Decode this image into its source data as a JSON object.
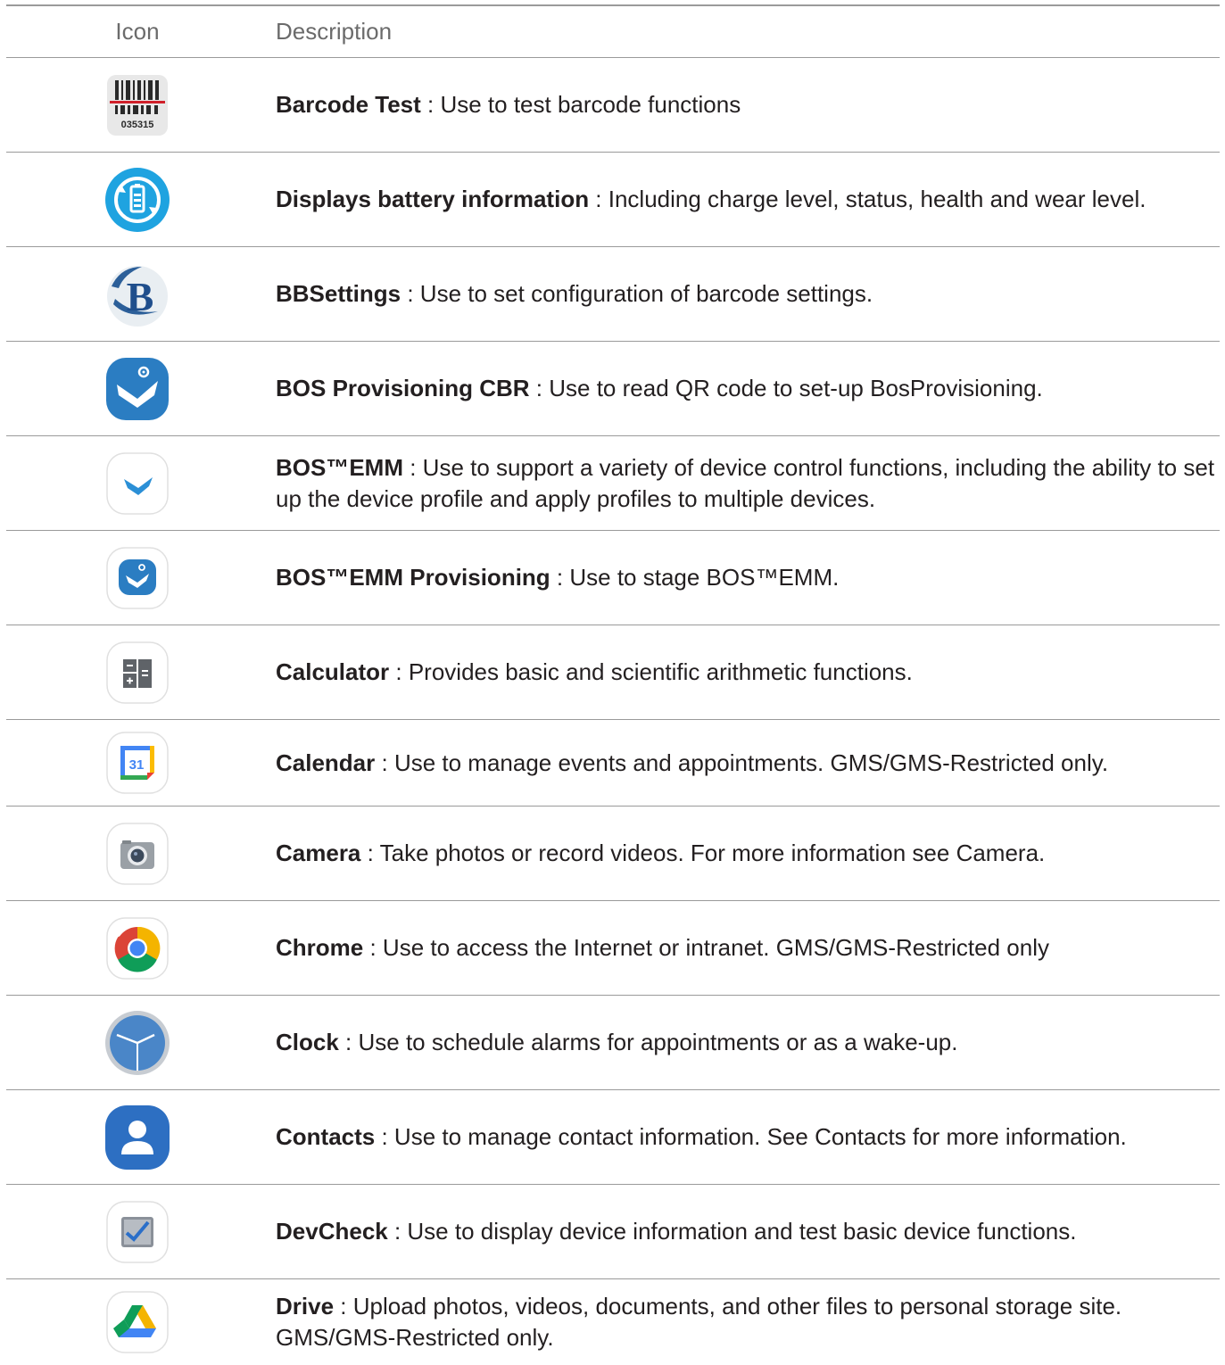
{
  "header": {
    "icon_col": "Icon",
    "desc_col": "Description"
  },
  "rows": [
    {
      "icon": "barcode-test-icon",
      "name": "Barcode Test",
      "sep": " : ",
      "desc": "Use to test barcode functions"
    },
    {
      "icon": "battery-info-icon",
      "name": "Displays battery information",
      "sep": " : ",
      "desc": "Including charge level, status, health and wear level."
    },
    {
      "icon": "bbsettings-icon",
      "name": "BBSettings",
      "sep": " : ",
      "desc": "Use to set configuration of barcode settings."
    },
    {
      "icon": "bos-provisioning-cbr-icon",
      "name": "BOS Provisioning CBR",
      "sep": " : ",
      "desc": "Use to read QR code to set-up BosProvisioning."
    },
    {
      "icon": "bos-emm-icon",
      "name": "BOS™EMM",
      "sep": " : ",
      "desc": "Use to support a variety of device control functions, including the ability to set up the device profile and apply profiles to multiple devices."
    },
    {
      "icon": "bos-emm-provisioning-icon",
      "name": "BOS™EMM Provisioning",
      "sep": " : ",
      "desc": "Use to stage BOS™EMM."
    },
    {
      "icon": "calculator-icon",
      "name": "Calculator",
      "sep": " : ",
      "desc": "Provides basic and scientific arithmetic functions."
    },
    {
      "icon": "calendar-icon",
      "icon_text": "31",
      "name": "Calendar",
      "sep": " : ",
      "desc": "Use to manage events and appointments. GMS/GMS-Restricted only."
    },
    {
      "icon": "camera-icon",
      "name": "Camera",
      "sep": " : ",
      "desc": "Take photos or record videos. For more information see Camera."
    },
    {
      "icon": "chrome-icon",
      "name": "Chrome",
      "sep": " : ",
      "desc": "Use to access the Internet or intranet. GMS/GMS-Restricted only"
    },
    {
      "icon": "clock-icon",
      "name": "Clock",
      "sep": " : ",
      "desc": "Use to schedule alarms for appointments or as a wake-up."
    },
    {
      "icon": "contacts-icon",
      "name": "Contacts",
      "sep": " : ",
      "desc": "Use to manage contact information. See Contacts for more information."
    },
    {
      "icon": "devcheck-icon",
      "name": "DevCheck",
      "sep": " : ",
      "desc": "Use to display device information and test basic device functions."
    },
    {
      "icon": "drive-icon",
      "name": "Drive",
      "sep": " : ",
      "desc": "Upload photos, videos, documents, and other files to personal storage site. GMS/GMS-Restricted only."
    }
  ],
  "barcode_digits": "035315",
  "colors": {
    "rule": "#9a9a9a",
    "header_text": "#6b6b6b",
    "body_text": "#231f20"
  }
}
